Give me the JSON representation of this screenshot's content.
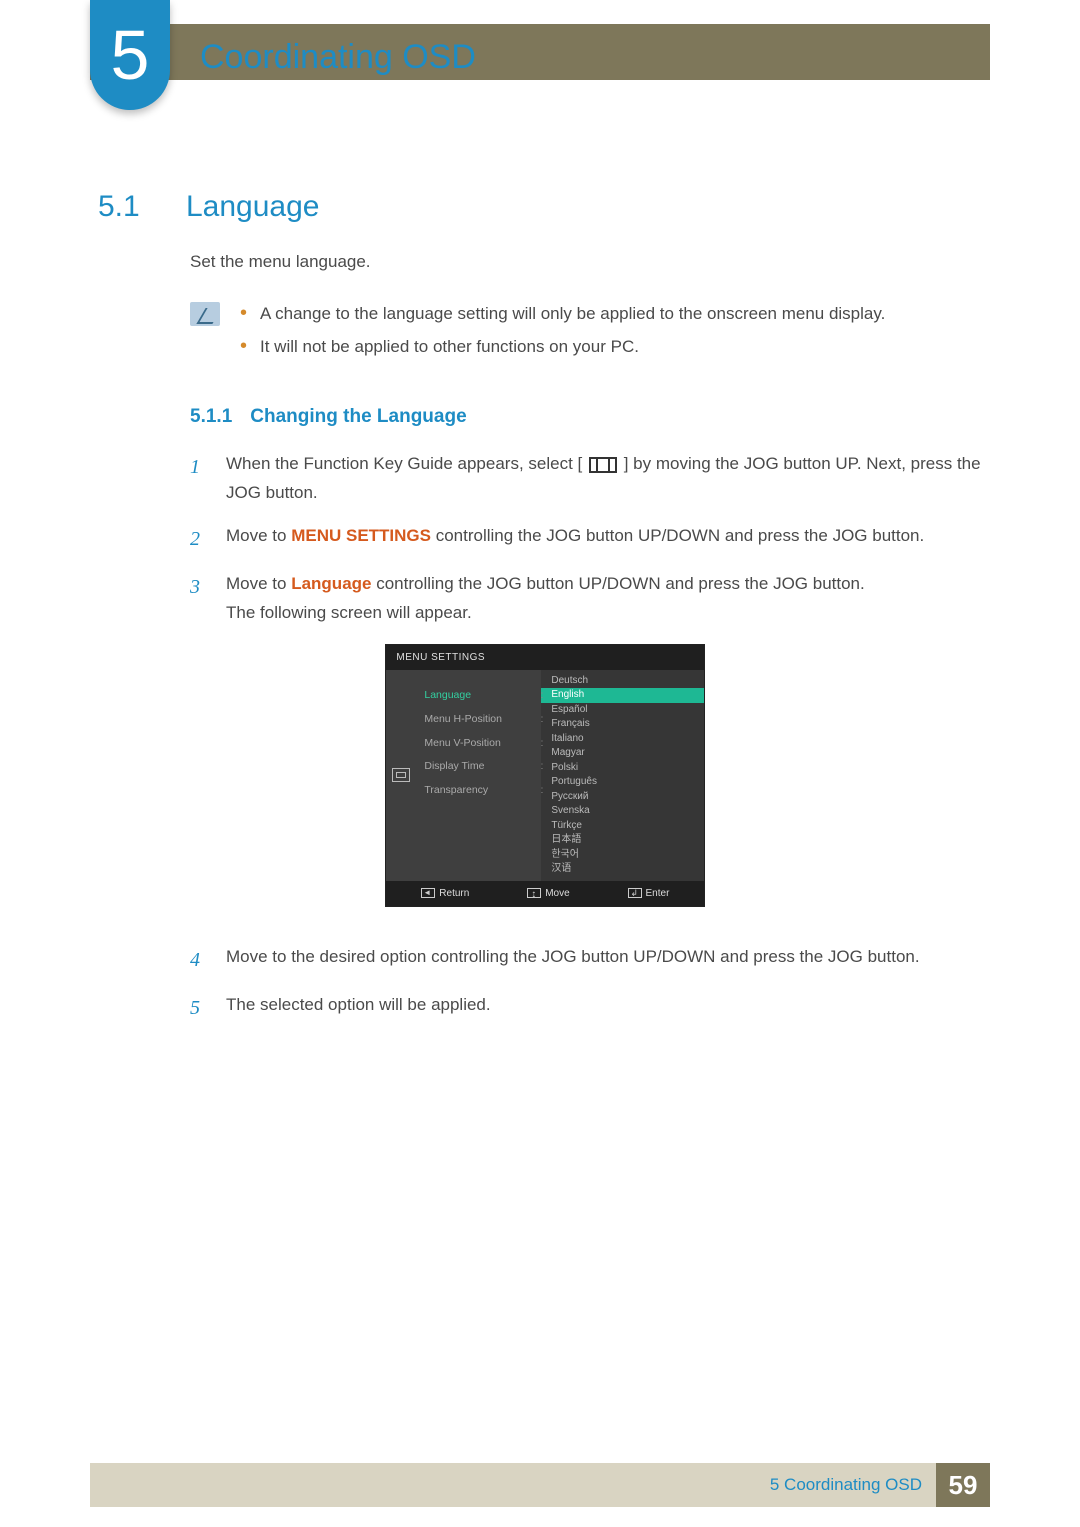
{
  "chapter": {
    "number": "5",
    "title": "Coordinating OSD"
  },
  "section": {
    "number": "5.1",
    "title": "Language",
    "intro": "Set the menu language."
  },
  "notes": [
    "A change to the language setting will only be applied to the onscreen menu display.",
    "It will not be applied to other functions on your PC."
  ],
  "subsection": {
    "number": "5.1.1",
    "title": "Changing the Language"
  },
  "steps": {
    "s1_a": "When the Function Key Guide appears, select [",
    "s1_b": "] by moving the JOG button UP. Next, press the JOG button.",
    "s2_a": "Move to ",
    "s2_hl": "MENU SETTINGS",
    "s2_b": " controlling the JOG button UP/DOWN and press the JOG button.",
    "s3_a": "Move to ",
    "s3_hl": "Language",
    "s3_b": " controlling the JOG button UP/DOWN and press the JOG button.",
    "s3_c": "The following screen will appear.",
    "s4": "Move to the desired option controlling the JOG button UP/DOWN and press the JOG button.",
    "s5": "The selected option will be applied."
  },
  "step_nums": {
    "n1": "1",
    "n2": "2",
    "n3": "3",
    "n4": "4",
    "n5": "5"
  },
  "osd": {
    "header": "MENU SETTINGS",
    "menu_items": {
      "m0": "Language",
      "m1": "Menu H-Position",
      "m2": "Menu V-Position",
      "m3": "Display Time",
      "m4": "Transparency"
    },
    "languages": {
      "l0": "Deutsch",
      "l1": "English",
      "l2": "Español",
      "l3": "Français",
      "l4": "Italiano",
      "l5": "Magyar",
      "l6": "Polski",
      "l7": "Português",
      "l8": "Русский",
      "l9": "Svenska",
      "l10": "Türkçe",
      "l11": "日本語",
      "l12": "한국어",
      "l13": "汉语"
    },
    "footer": {
      "return": "Return",
      "move": "Move",
      "enter": "Enter"
    }
  },
  "footer": {
    "label": "5 Coordinating OSD",
    "page": "59"
  }
}
